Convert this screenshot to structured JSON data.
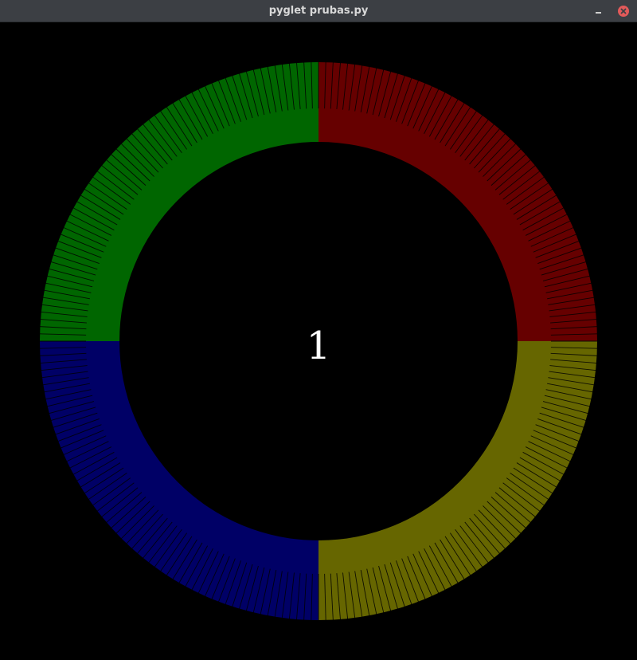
{
  "window": {
    "title": "pyglet prubas.py"
  },
  "titlebar_icons": {
    "minimize": "minimize-icon",
    "close": "close-icon"
  },
  "display": {
    "counter": "1"
  },
  "ring": {
    "colors": {
      "top_right": "#660000",
      "bottom_right": "#666600",
      "bottom_left": "#000066",
      "top_left": "#006600"
    }
  }
}
